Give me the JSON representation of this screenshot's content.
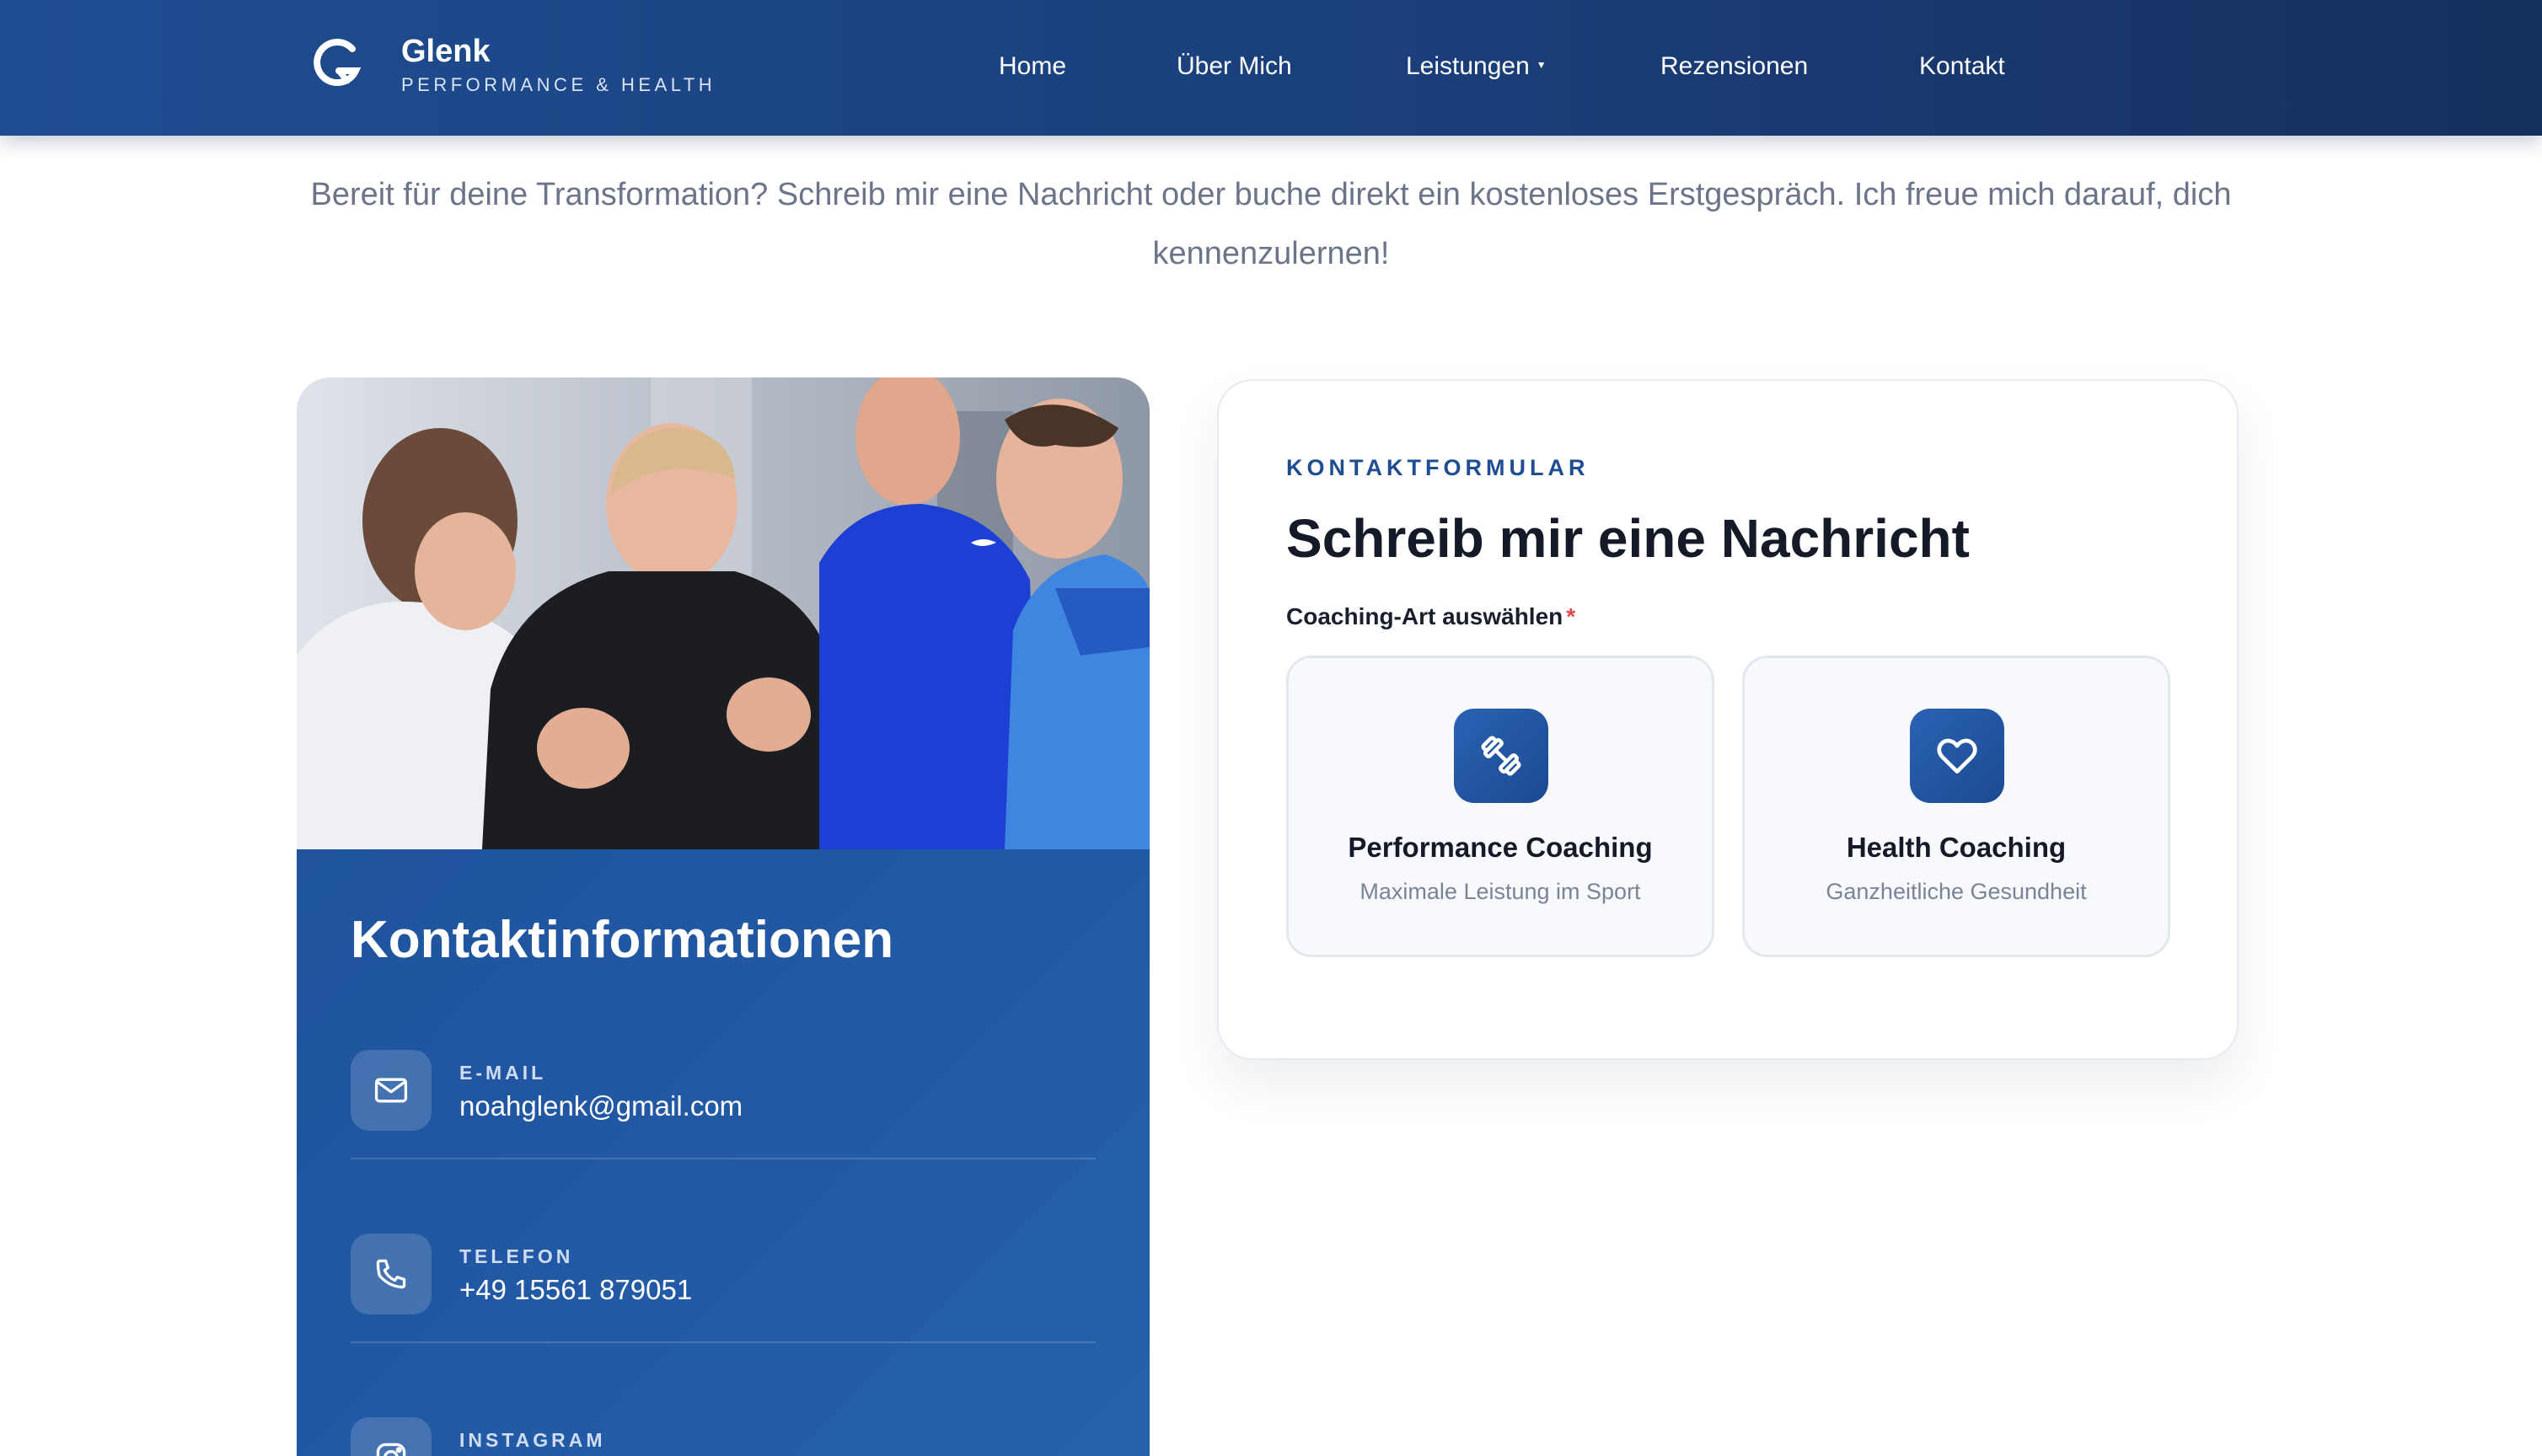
{
  "header": {
    "brand_name": "Glenk",
    "brand_tagline": "PERFORMANCE & HEALTH",
    "nav": [
      {
        "label": "Home"
      },
      {
        "label": "Über Mich"
      },
      {
        "label": "Leistungen",
        "has_dropdown": true
      },
      {
        "label": "Rezensionen"
      },
      {
        "label": "Kontakt"
      }
    ]
  },
  "intro": {
    "text": "Bereit für deine Transformation? Schreib mir eine Nachricht oder buche direkt ein kostenloses Erstgespräch. Ich freue mich darauf, dich kennenzulernen!"
  },
  "contact_info": {
    "title": "Kontaktinformationen",
    "items": [
      {
        "label": "E-MAIL",
        "value": "noahglenk@gmail.com",
        "icon": "mail-icon"
      },
      {
        "label": "TELEFON",
        "value": "+49 15561 879051",
        "icon": "phone-icon"
      },
      {
        "label": "INSTAGRAM",
        "value": "",
        "icon": "instagram-icon"
      }
    ]
  },
  "form": {
    "kicker": "KONTAKTFORMULAR",
    "title": "Schreib mir eine Nachricht",
    "coaching_label": "Coaching-Art auswählen",
    "required_mark": "*",
    "options": [
      {
        "title": "Performance Coaching",
        "subtitle": "Maximale Leistung im Sport",
        "icon": "dumbbell-icon"
      },
      {
        "title": "Health Coaching",
        "subtitle": "Ganzheitliche Gesundheit",
        "icon": "heart-icon"
      }
    ]
  },
  "colors": {
    "brand_blue": "#1f4d92",
    "panel_blue": "#2260a9",
    "required_red": "#e24a4a"
  }
}
